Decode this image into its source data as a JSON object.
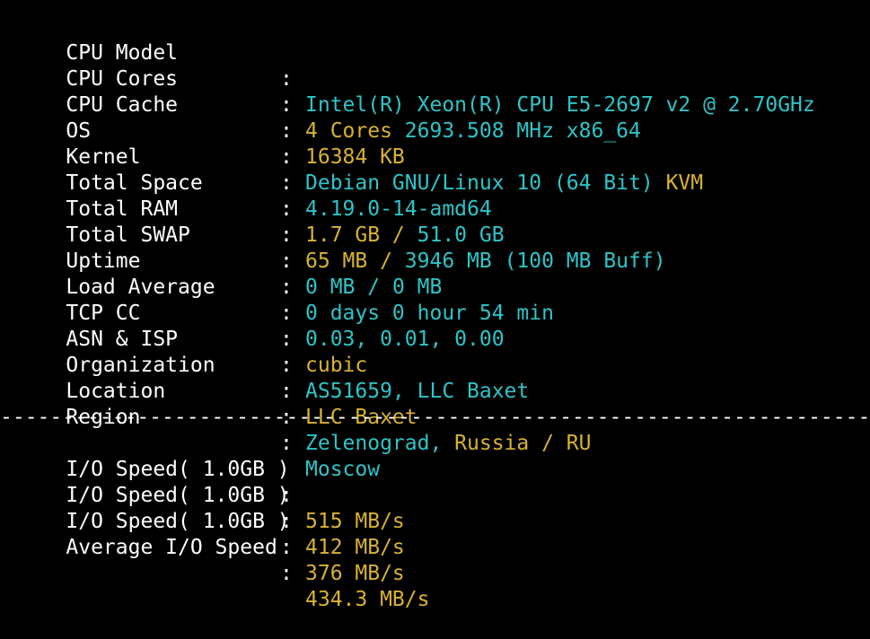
{
  "colors": {
    "background": "#000000",
    "label": "#ffffff",
    "cyan": "#2ec4c8",
    "yellow": "#d8b232"
  },
  "separator": ":",
  "system_info": [
    {
      "label": "CPU Model",
      "parts": [
        {
          "text": "Intel(R) Xeon(R) CPU E5-2697 v2 @ 2.70GHz",
          "color": "cyan"
        }
      ]
    },
    {
      "label": "CPU Cores",
      "parts": [
        {
          "text": "4 Cores ",
          "color": "yellow"
        },
        {
          "text": "2693.508 MHz x86_64",
          "color": "cyan"
        }
      ]
    },
    {
      "label": "CPU Cache",
      "parts": [
        {
          "text": "16384 KB",
          "color": "yellow"
        }
      ]
    },
    {
      "label": "OS",
      "parts": [
        {
          "text": "Debian GNU/Linux 10 (64 Bit) ",
          "color": "cyan"
        },
        {
          "text": "KVM",
          "color": "yellow"
        }
      ]
    },
    {
      "label": "Kernel",
      "parts": [
        {
          "text": "4.19.0-14-amd64",
          "color": "cyan"
        }
      ]
    },
    {
      "label": "Total Space",
      "parts": [
        {
          "text": "1.7 GB / ",
          "color": "yellow"
        },
        {
          "text": "51.0 GB",
          "color": "cyan"
        }
      ]
    },
    {
      "label": "Total RAM",
      "parts": [
        {
          "text": "65 MB / ",
          "color": "yellow"
        },
        {
          "text": "3946 MB ",
          "color": "cyan"
        },
        {
          "text": "(100 MB Buff)",
          "color": "cyan"
        }
      ]
    },
    {
      "label": "Total SWAP",
      "parts": [
        {
          "text": "0 MB / ",
          "color": "cyan"
        },
        {
          "text": "0 MB",
          "color": "cyan"
        }
      ]
    },
    {
      "label": "Uptime",
      "parts": [
        {
          "text": "0 days 0 hour 54 min",
          "color": "cyan"
        }
      ]
    },
    {
      "label": "Load Average",
      "parts": [
        {
          "text": "0.03, 0.01, 0.00",
          "color": "cyan"
        }
      ]
    },
    {
      "label": "TCP CC",
      "parts": [
        {
          "text": "cubic",
          "color": "yellow"
        }
      ]
    },
    {
      "label": "ASN & ISP",
      "parts": [
        {
          "text": "AS51659, LLC Baxet",
          "color": "cyan"
        }
      ]
    },
    {
      "label": "Organization",
      "parts": [
        {
          "text": "LLC Baxet",
          "color": "yellow"
        }
      ]
    },
    {
      "label": "Location",
      "parts": [
        {
          "text": "Zelenograd, ",
          "color": "cyan"
        },
        {
          "text": "Russia / RU",
          "color": "yellow"
        }
      ]
    },
    {
      "label": "Region",
      "parts": [
        {
          "text": "Moscow",
          "color": "cyan"
        }
      ]
    }
  ],
  "divider_text": "----------------------------------------------------------------------",
  "io_info": [
    {
      "label": "I/O Speed( 1.0GB )",
      "parts": [
        {
          "text": "515 MB/s",
          "color": "yellow"
        }
      ]
    },
    {
      "label": "I/O Speed( 1.0GB )",
      "parts": [
        {
          "text": "412 MB/s",
          "color": "yellow"
        }
      ]
    },
    {
      "label": "I/O Speed( 1.0GB )",
      "parts": [
        {
          "text": "376 MB/s",
          "color": "yellow"
        }
      ]
    },
    {
      "label": "Average I/O Speed",
      "parts": [
        {
          "text": "434.3 MB/s",
          "color": "yellow"
        }
      ]
    }
  ]
}
